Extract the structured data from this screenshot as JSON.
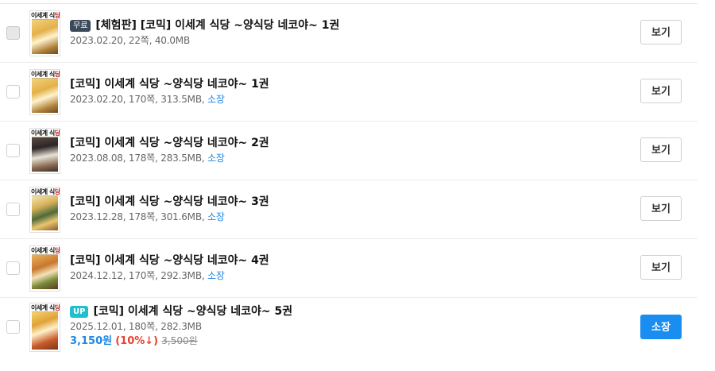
{
  "rows": [
    {
      "badge": "무료",
      "title": "[체험판] [코믹] 이세계 식당 ~양식당 네코야~ 1권",
      "meta": "2023.02.20, 22쪽, 40.0MB",
      "owned": "",
      "button": "보기",
      "cover_title": "이세계 식당"
    },
    {
      "title": "[코믹] 이세계 식당 ~양식당 네코야~ 1권",
      "meta": "2023.02.20, 170쪽, 313.5MB,",
      "owned": "소장",
      "button": "보기",
      "cover_title": "이세계 식당"
    },
    {
      "title": "[코믹] 이세계 식당 ~양식당 네코야~ 2권",
      "meta": "2023.08.08, 178쪽, 283.5MB,",
      "owned": "소장",
      "button": "보기",
      "cover_title": "이세계 식당"
    },
    {
      "title": "[코믹] 이세계 식당 ~양식당 네코야~ 3권",
      "meta": "2023.12.28, 178쪽, 301.6MB,",
      "owned": "소장",
      "button": "보기",
      "cover_title": "이세계 식당"
    },
    {
      "title": "[코믹] 이세계 식당 ~양식당 네코야~ 4권",
      "meta": "2024.12.12, 170쪽, 292.3MB,",
      "owned": "소장",
      "button": "보기",
      "cover_title": "이세계 식당"
    },
    {
      "badge": "UP",
      "title": "[코믹] 이세계 식당 ~양식당 네코야~ 5권",
      "meta": "2025.12.01, 180쪽, 282.3MB",
      "price": "3,150원",
      "discount": "(10%↓)",
      "original_price": "3,500원",
      "button": "소장",
      "cover_title": "이세계 식당"
    }
  ],
  "colors": {
    "accent": "#1a8ef0",
    "owned_link": "#1e88e5",
    "discount": "#e5432d",
    "free_badge": "#3b4a5b",
    "up_badge": "#1fbfd0"
  }
}
